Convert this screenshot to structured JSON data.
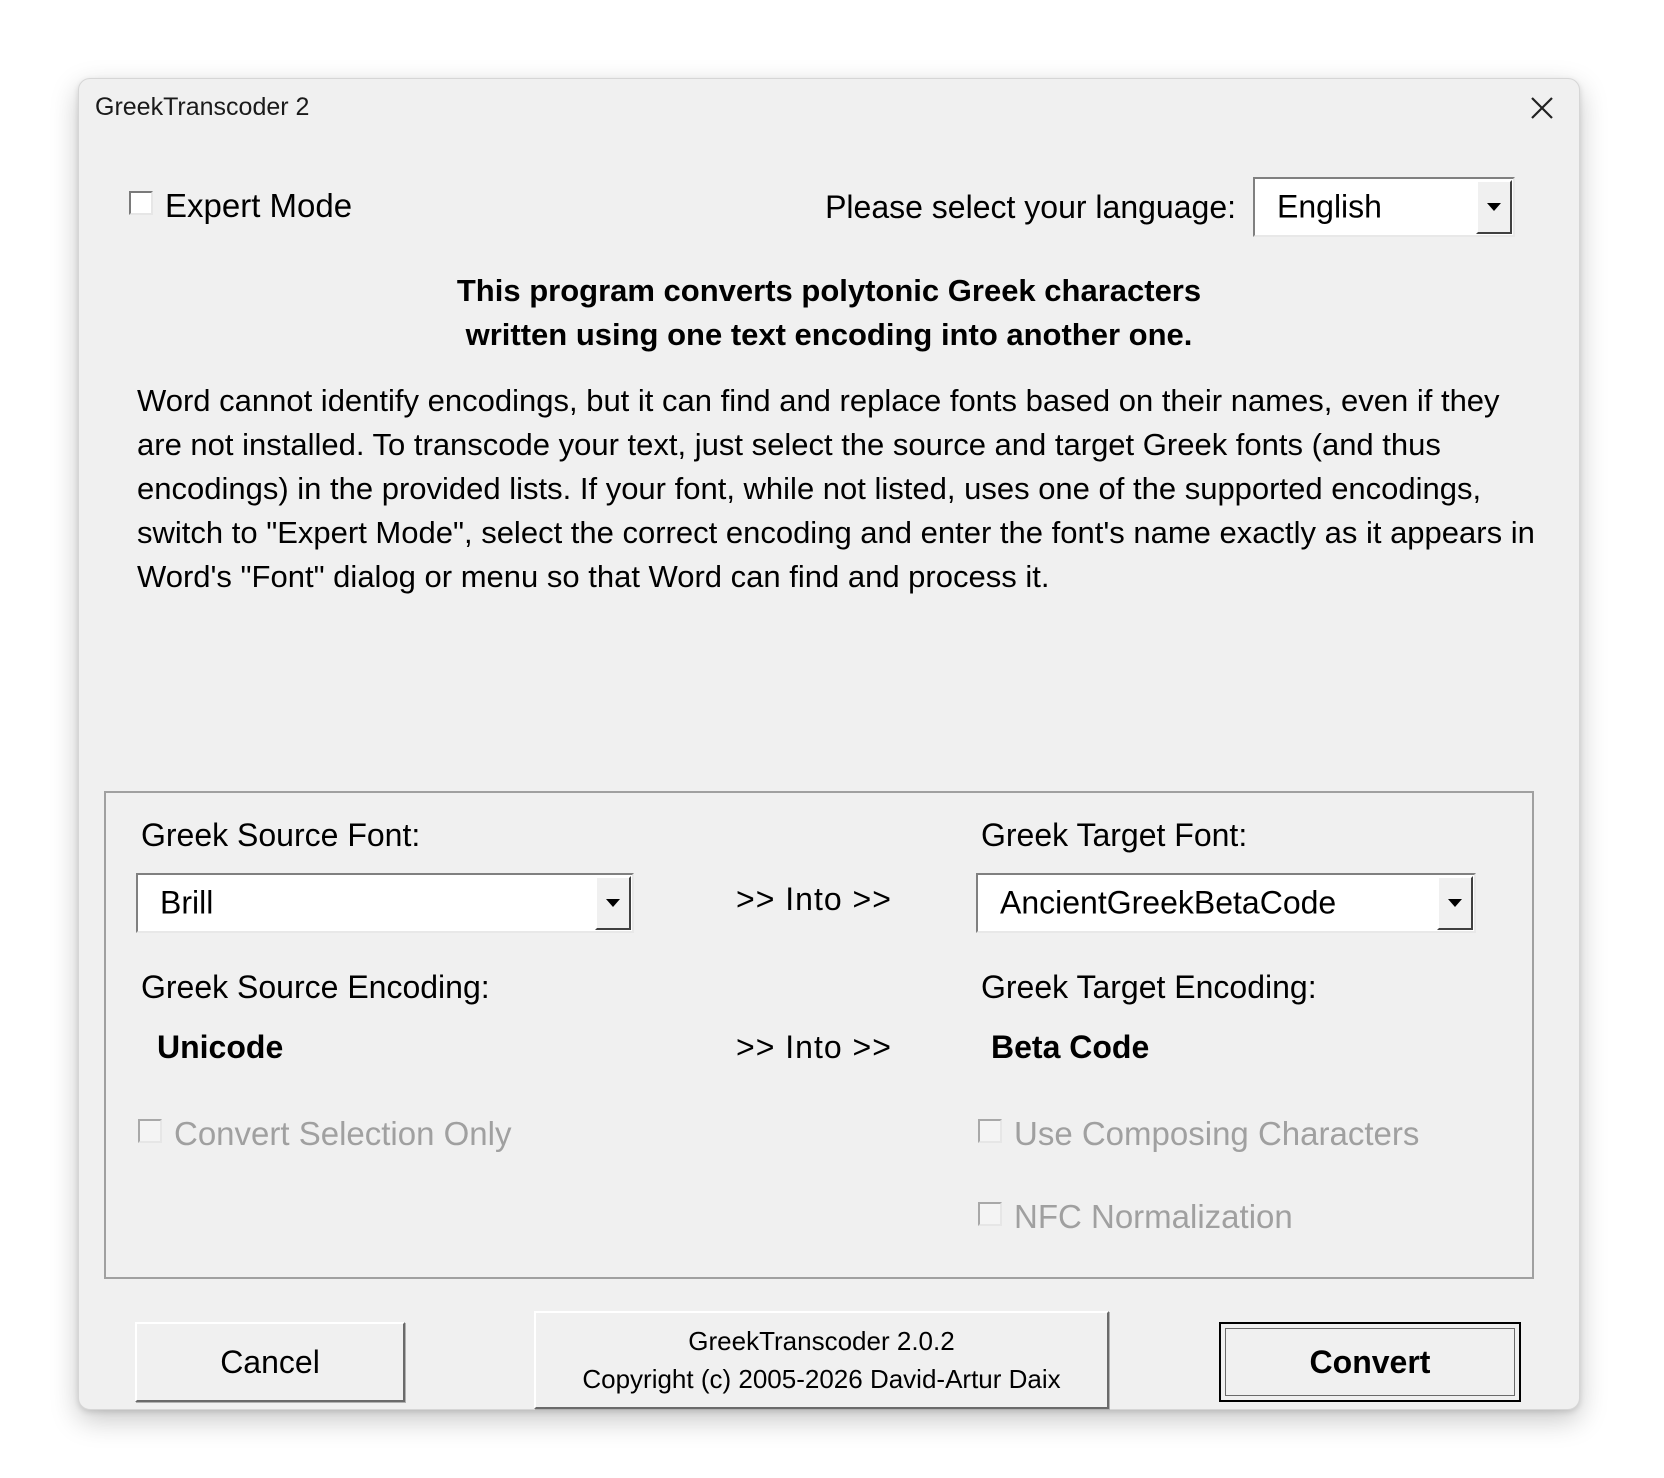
{
  "window": {
    "title": "GreekTranscoder 2"
  },
  "expert_mode": {
    "label": "Expert Mode",
    "checked": false
  },
  "language": {
    "label": "Please select your language:",
    "selected": "English"
  },
  "heading": {
    "line1": "This program converts polytonic Greek characters",
    "line2": "written using one text encoding into another one."
  },
  "description": "Word cannot identify encodings, but it can find and replace fonts based on their names, even if they are not installed. To transcode your text, just select the source and target Greek fonts (and thus encodings) in the provided lists. If your font, while not listed, uses one of the supported encodings, switch to \"Expert Mode\", select the correct encoding and enter the font's name exactly as it appears in Word's \"Font\" dialog or menu so that Word can find and process it.",
  "source": {
    "font_label": "Greek Source Font:",
    "font_value": "Brill",
    "encoding_label": "Greek Source Encoding:",
    "encoding_value": "Unicode",
    "convert_selection_label": "Convert Selection Only"
  },
  "target": {
    "font_label": "Greek Target Font:",
    "font_value": "AncientGreekBetaCode",
    "encoding_label": "Greek Target Encoding:",
    "encoding_value": "Beta Code",
    "composing_label": "Use Composing Characters",
    "nfc_label": "NFC Normalization"
  },
  "into_text": ">>  Into  >>",
  "buttons": {
    "cancel": "Cancel",
    "about_line1": "GreekTranscoder 2.0.2",
    "about_line2": "Copyright (c) 2005-2026 David-Artur Daix",
    "convert": "Convert"
  },
  "icons": {
    "close": "close-icon",
    "dropdown": "dropdown-arrow-icon"
  }
}
